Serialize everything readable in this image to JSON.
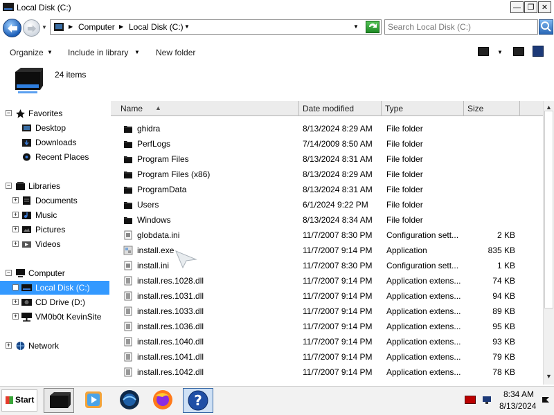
{
  "window": {
    "title": "Local Disk (C:)",
    "minimize": "0",
    "maximize": "1",
    "close": "r"
  },
  "address": {
    "crumbs": [
      "Computer",
      "Local Disk (C:)"
    ],
    "search_placeholder": "Search Local Disk (C:)"
  },
  "toolbar": {
    "organize": "Organize",
    "include_in_library": "Include in library",
    "new_folder": "New folder"
  },
  "info": {
    "item_count": "24 items"
  },
  "nav": {
    "favorites": {
      "label": "Favorites",
      "items": [
        "Desktop",
        "Downloads",
        "Recent Places"
      ]
    },
    "libraries": {
      "label": "Libraries",
      "items": [
        "Documents",
        "Music",
        "Pictures",
        "Videos"
      ]
    },
    "computer": {
      "label": "Computer",
      "items": [
        "Local Disk (C:)",
        "CD Drive (D:)",
        "VM0b0t KevinSite"
      ],
      "selected": "Local Disk (C:)"
    },
    "network": {
      "label": "Network"
    }
  },
  "columns": {
    "name": "Name",
    "date": "Date modified",
    "type": "Type",
    "size": "Size"
  },
  "files": [
    {
      "name": "ghidra",
      "date": "8/13/2024 8:29 AM",
      "type": "File folder",
      "size": "",
      "icon": "folder-icon"
    },
    {
      "name": "PerfLogs",
      "date": "7/14/2009 8:50 AM",
      "type": "File folder",
      "size": "",
      "icon": "folder-icon"
    },
    {
      "name": "Program Files",
      "date": "8/13/2024 8:31 AM",
      "type": "File folder",
      "size": "",
      "icon": "folder-icon"
    },
    {
      "name": "Program Files (x86)",
      "date": "8/13/2024 8:29 AM",
      "type": "File folder",
      "size": "",
      "icon": "folder-icon"
    },
    {
      "name": "ProgramData",
      "date": "8/13/2024 8:31 AM",
      "type": "File folder",
      "size": "",
      "icon": "folder-icon"
    },
    {
      "name": "Users",
      "date": "6/1/2024 9:22 PM",
      "type": "File folder",
      "size": "",
      "icon": "folder-icon"
    },
    {
      "name": "Windows",
      "date": "8/13/2024 8:34 AM",
      "type": "File folder",
      "size": "",
      "icon": "folder-icon"
    },
    {
      "name": "globdata.ini",
      "date": "11/7/2007 8:30 PM",
      "type": "Configuration sett...",
      "size": "2 KB",
      "icon": "ini-file-icon"
    },
    {
      "name": "install.exe",
      "date": "11/7/2007 9:14 PM",
      "type": "Application",
      "size": "835 KB",
      "icon": "exe-file-icon"
    },
    {
      "name": "install.ini",
      "date": "11/7/2007 8:30 PM",
      "type": "Configuration sett...",
      "size": "1 KB",
      "icon": "ini-file-icon"
    },
    {
      "name": "install.res.1028.dll",
      "date": "11/7/2007 9:14 PM",
      "type": "Application extens...",
      "size": "74 KB",
      "icon": "dll-file-icon"
    },
    {
      "name": "install.res.1031.dll",
      "date": "11/7/2007 9:14 PM",
      "type": "Application extens...",
      "size": "94 KB",
      "icon": "dll-file-icon"
    },
    {
      "name": "install.res.1033.dll",
      "date": "11/7/2007 9:14 PM",
      "type": "Application extens...",
      "size": "89 KB",
      "icon": "dll-file-icon"
    },
    {
      "name": "install.res.1036.dll",
      "date": "11/7/2007 9:14 PM",
      "type": "Application extens...",
      "size": "95 KB",
      "icon": "dll-file-icon"
    },
    {
      "name": "install.res.1040.dll",
      "date": "11/7/2007 9:14 PM",
      "type": "Application extens...",
      "size": "93 KB",
      "icon": "dll-file-icon"
    },
    {
      "name": "install.res.1041.dll",
      "date": "11/7/2007 9:14 PM",
      "type": "Application extens...",
      "size": "79 KB",
      "icon": "dll-file-icon"
    },
    {
      "name": "install.res.1042.dll",
      "date": "11/7/2007 9:14 PM",
      "type": "Application extens...",
      "size": "78 KB",
      "icon": "dll-file-icon"
    }
  ],
  "taskbar": {
    "start": "Start",
    "apps": [
      "explorer-icon",
      "media-player-icon",
      "internet-explorer-icon",
      "firefox-icon",
      "help-icon"
    ],
    "clock_time": "8:34 AM",
    "clock_date": "8/13/2024"
  },
  "colors": {
    "selection": "#3399ff",
    "header_bg": "#ececec"
  }
}
